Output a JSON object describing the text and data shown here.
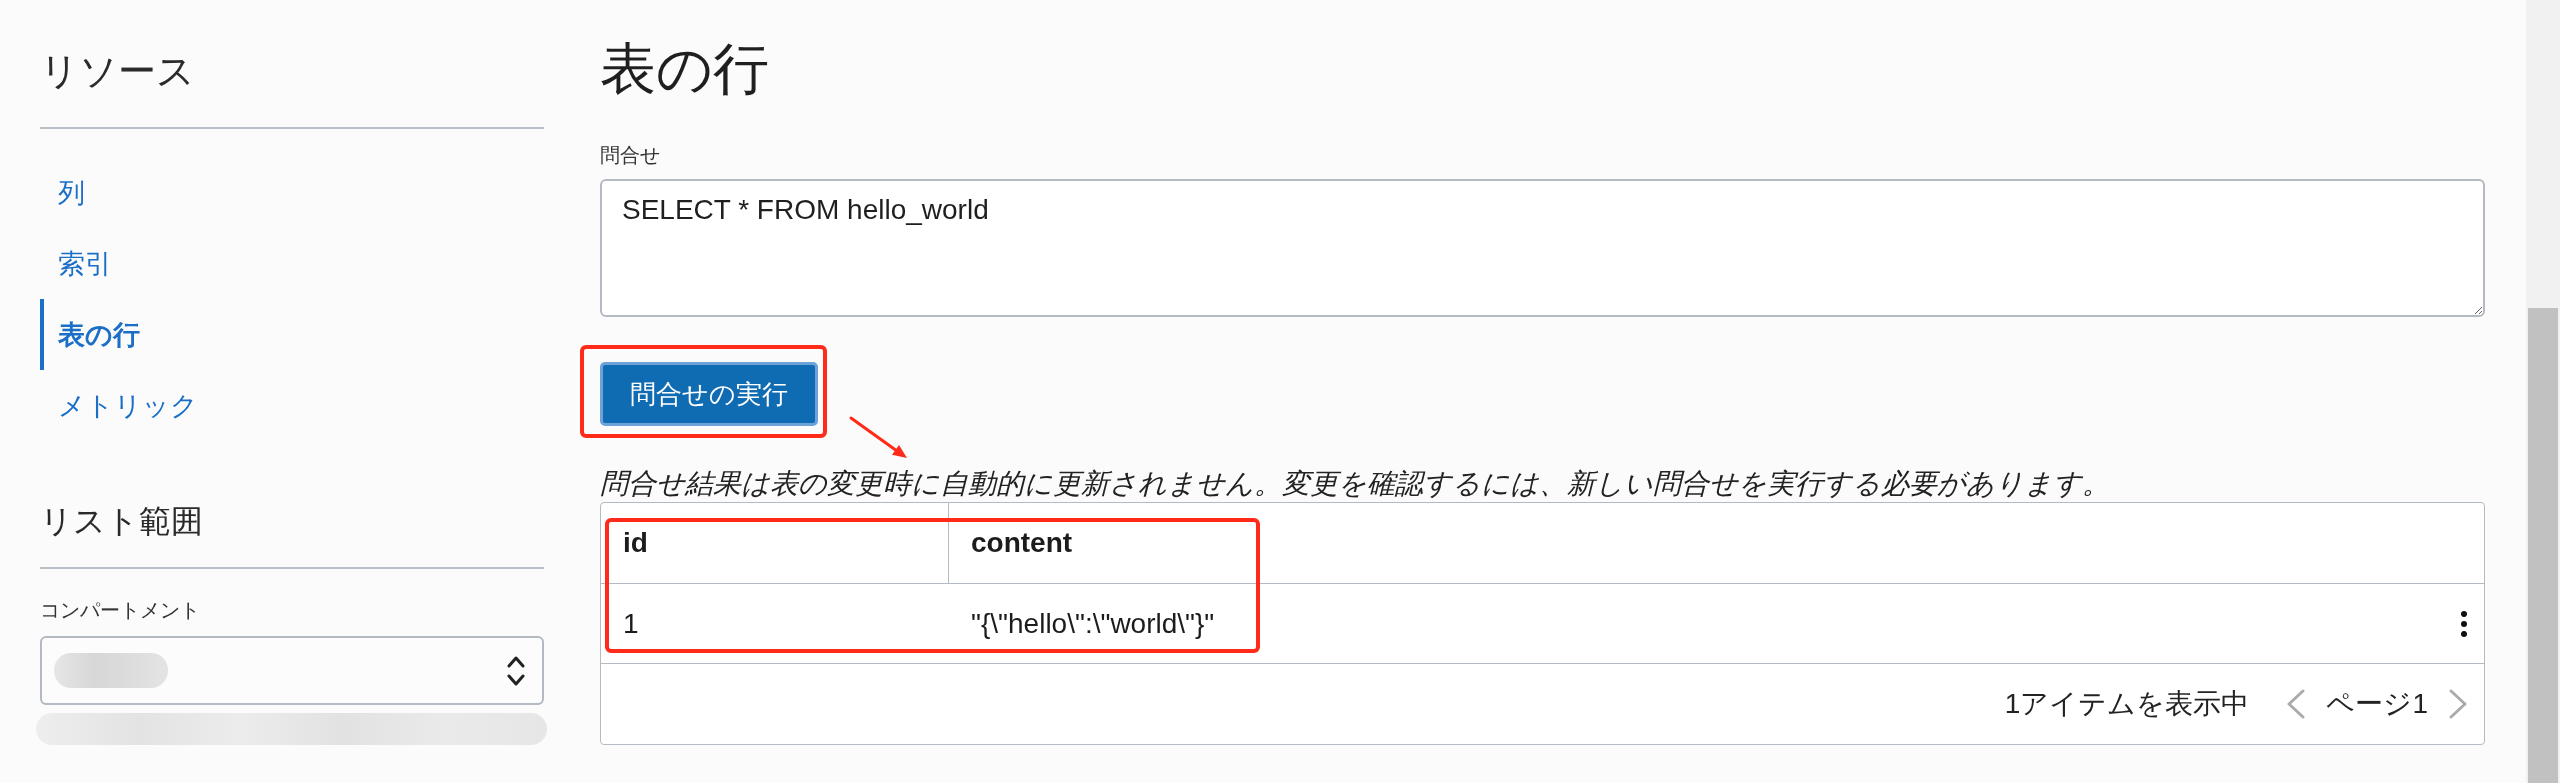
{
  "sidebar": {
    "resources": {
      "title": "リソース",
      "items": [
        {
          "label": "列",
          "selected": false
        },
        {
          "label": "索引",
          "selected": false
        },
        {
          "label": "表の行",
          "selected": true
        },
        {
          "label": "メトリック",
          "selected": false
        }
      ]
    },
    "list_scope": {
      "title": "リスト範囲",
      "compartment": {
        "label": "コンパートメント"
      }
    }
  },
  "main": {
    "title": "表の行",
    "query": {
      "label": "問合せ",
      "value": "SELECT * FROM hello_world"
    },
    "run_button": {
      "label": "問合せの実行"
    },
    "note": "問合せ結果は表の変更時に自動的に更新されません。変更を確認するには、新しい問合せを実行する必要があります。",
    "table": {
      "columns": [
        "id",
        "content"
      ],
      "rows": [
        {
          "cells": [
            "1",
            "\"{\\\"hello\\\":\\\"world\\\"}\""
          ]
        }
      ],
      "footer": {
        "count": "1アイテムを表示中",
        "page": "ページ1",
        "prev": {
          "disabled": true
        },
        "next": {
          "disabled": true
        }
      }
    }
  }
}
